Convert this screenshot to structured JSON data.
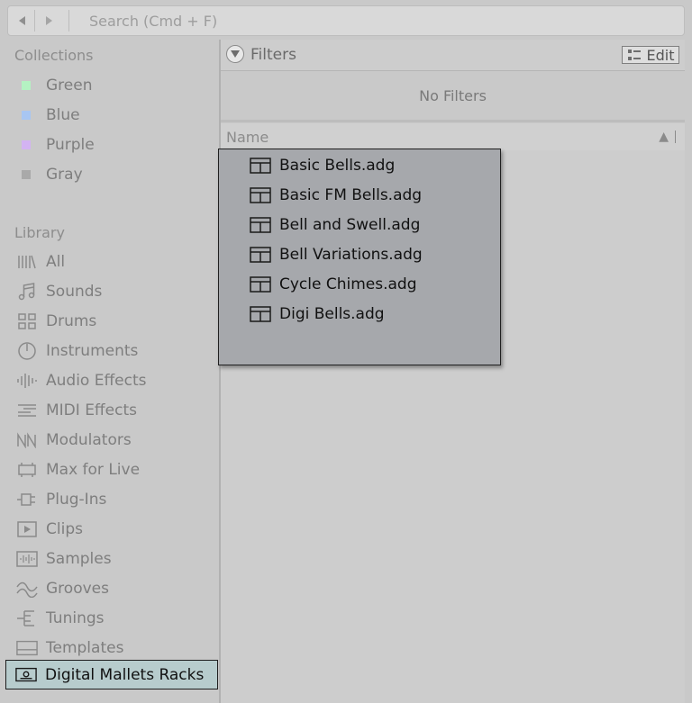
{
  "toolbar": {
    "back_icon": "back-arrow-icon",
    "forward_icon": "forward-arrow-icon",
    "search_placeholder": "Search (Cmd + F)"
  },
  "collections": {
    "heading": "Collections",
    "items": [
      {
        "label": "Green",
        "color": "#b4f2c2"
      },
      {
        "label": "Blue",
        "color": "#a8c6f2"
      },
      {
        "label": "Purple",
        "color": "#d3b3f2"
      },
      {
        "label": "Gray",
        "color": "#a9a9a9"
      }
    ]
  },
  "library": {
    "heading": "Library",
    "items": [
      {
        "label": "All",
        "icon": "all-icon"
      },
      {
        "label": "Sounds",
        "icon": "sounds-icon"
      },
      {
        "label": "Drums",
        "icon": "drums-icon"
      },
      {
        "label": "Instruments",
        "icon": "instruments-icon"
      },
      {
        "label": "Audio Effects",
        "icon": "audio-effects-icon"
      },
      {
        "label": "MIDI Effects",
        "icon": "midi-effects-icon"
      },
      {
        "label": "Modulators",
        "icon": "modulators-icon"
      },
      {
        "label": "Max for Live",
        "icon": "max-for-live-icon"
      },
      {
        "label": "Plug-Ins",
        "icon": "plug-ins-icon"
      },
      {
        "label": "Clips",
        "icon": "clips-icon"
      },
      {
        "label": "Samples",
        "icon": "samples-icon"
      },
      {
        "label": "Grooves",
        "icon": "grooves-icon"
      },
      {
        "label": "Tunings",
        "icon": "tunings-icon"
      },
      {
        "label": "Templates",
        "icon": "templates-icon"
      }
    ],
    "selected_folder": "Digital Mallets Racks"
  },
  "filters": {
    "label": "Filters",
    "edit_label": "Edit",
    "empty_text": "No Filters"
  },
  "list": {
    "column_name": "Name"
  },
  "drag_popup": {
    "items": [
      "Basic Bells.adg",
      "Basic FM Bells.adg",
      "Bell and Swell.adg",
      "Bell Variations.adg",
      "Cycle Chimes.adg",
      "Digi Bells.adg"
    ]
  },
  "colors": {
    "selection": "#b7cccd",
    "popup": "#a6a8ac"
  }
}
